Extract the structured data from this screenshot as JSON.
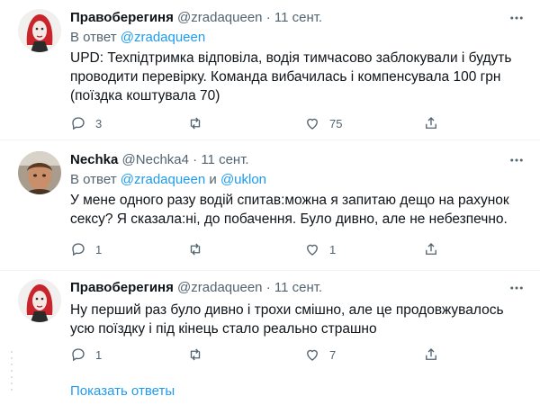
{
  "tweets": [
    {
      "name": "Правоберегиня",
      "handle": "@zradaqueen",
      "dot": "·",
      "time": "11 сент.",
      "replying_prefix": "В ответ ",
      "replying_to": "@zradaqueen",
      "replying_and": "",
      "replying_to2": "",
      "text": "UPD: Техпідтримка відповіла, водія тимчасово заблокували і будуть проводити перевірку. Команда вибачилась і компенсувала 100 грн (поїздка коштувала 70)",
      "reply_count": "3",
      "retweet_count": "",
      "like_count": "75"
    },
    {
      "name": "Nechka",
      "handle": "@Nechka4",
      "dot": "·",
      "time": "11 сент.",
      "replying_prefix": "В ответ ",
      "replying_to": "@zradaqueen",
      "replying_and": " и ",
      "replying_to2": "@uklon",
      "text": "У мене одного разу водій спитав:можна я запитаю дещо на рахунок сексу? Я сказала:ні, до побачення. Було дивно, але не небезпечно.",
      "reply_count": "1",
      "retweet_count": "",
      "like_count": "1"
    },
    {
      "name": "Правоберегиня",
      "handle": "@zradaqueen",
      "dot": "·",
      "time": "11 сент.",
      "text": "Ну перший раз було дивно і трохи смішно, але це продовжувалось усю поїздку і під кінець стало реально страшно",
      "reply_count": "1",
      "retweet_count": "",
      "like_count": "7"
    }
  ],
  "show_replies": "Показать ответы",
  "colors": {
    "accent": "#1d9bf0",
    "muted": "#536471",
    "text": "#0f1419",
    "divider": "#eff3f4"
  },
  "icons": [
    "more-icon",
    "reply-icon",
    "retweet-icon",
    "like-icon",
    "share-icon"
  ]
}
